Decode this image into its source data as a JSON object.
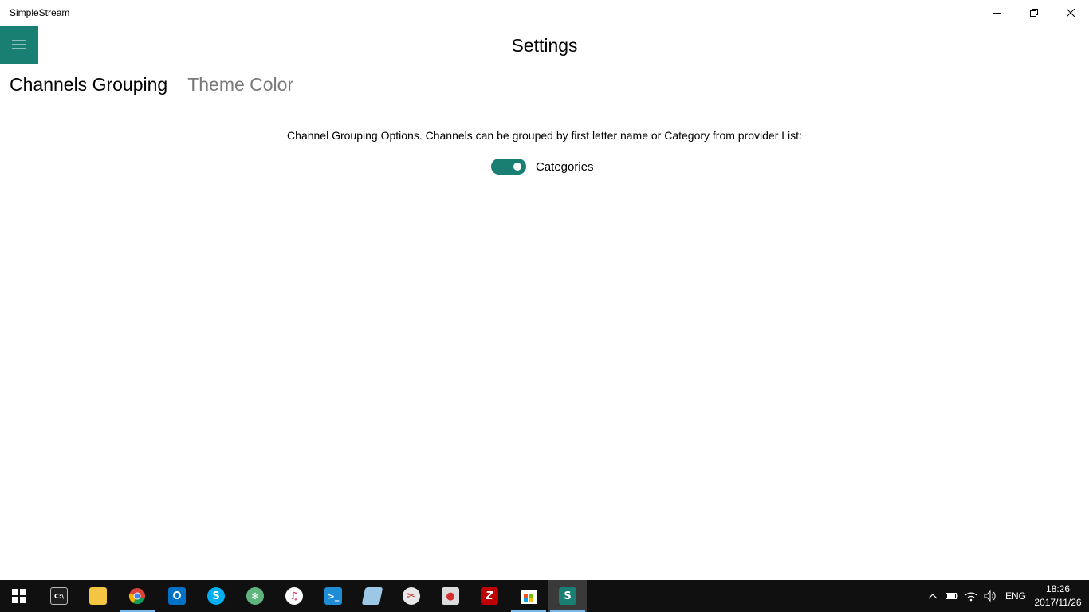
{
  "window": {
    "title": "SimpleStream"
  },
  "header": {
    "title": "Settings"
  },
  "pivot": {
    "tabs": [
      {
        "label": "Channels Grouping",
        "active": true
      },
      {
        "label": "Theme Color",
        "active": false
      }
    ]
  },
  "content": {
    "description": "Channel Grouping Options. Channels can be grouped by first letter name or Category from provider List:",
    "toggle": {
      "label": "Categories",
      "on": true
    }
  },
  "taskbar": {
    "apps": [
      {
        "name": "cmd-icon",
        "running": false
      },
      {
        "name": "file-explorer-icon",
        "running": false
      },
      {
        "name": "chrome-icon",
        "running": true
      },
      {
        "name": "outlook-icon",
        "running": false
      },
      {
        "name": "skype-icon",
        "running": false
      },
      {
        "name": "atom-icon",
        "running": false
      },
      {
        "name": "itunes-icon",
        "running": false
      },
      {
        "name": "powershell-icon",
        "running": false
      },
      {
        "name": "notes-icon",
        "running": false
      },
      {
        "name": "snipping-icon",
        "running": false
      },
      {
        "name": "recorder-icon",
        "running": false
      },
      {
        "name": "filezilla-icon",
        "running": false
      },
      {
        "name": "store-icon",
        "running": true
      },
      {
        "name": "simplestream-icon",
        "running": true,
        "active": true
      }
    ],
    "language": "ENG",
    "time": "18:26",
    "date": "2017/11/26"
  },
  "colors": {
    "accent": "#1a7f73",
    "taskbar": "#101010",
    "inactive_tab": "#7a7a7a"
  }
}
